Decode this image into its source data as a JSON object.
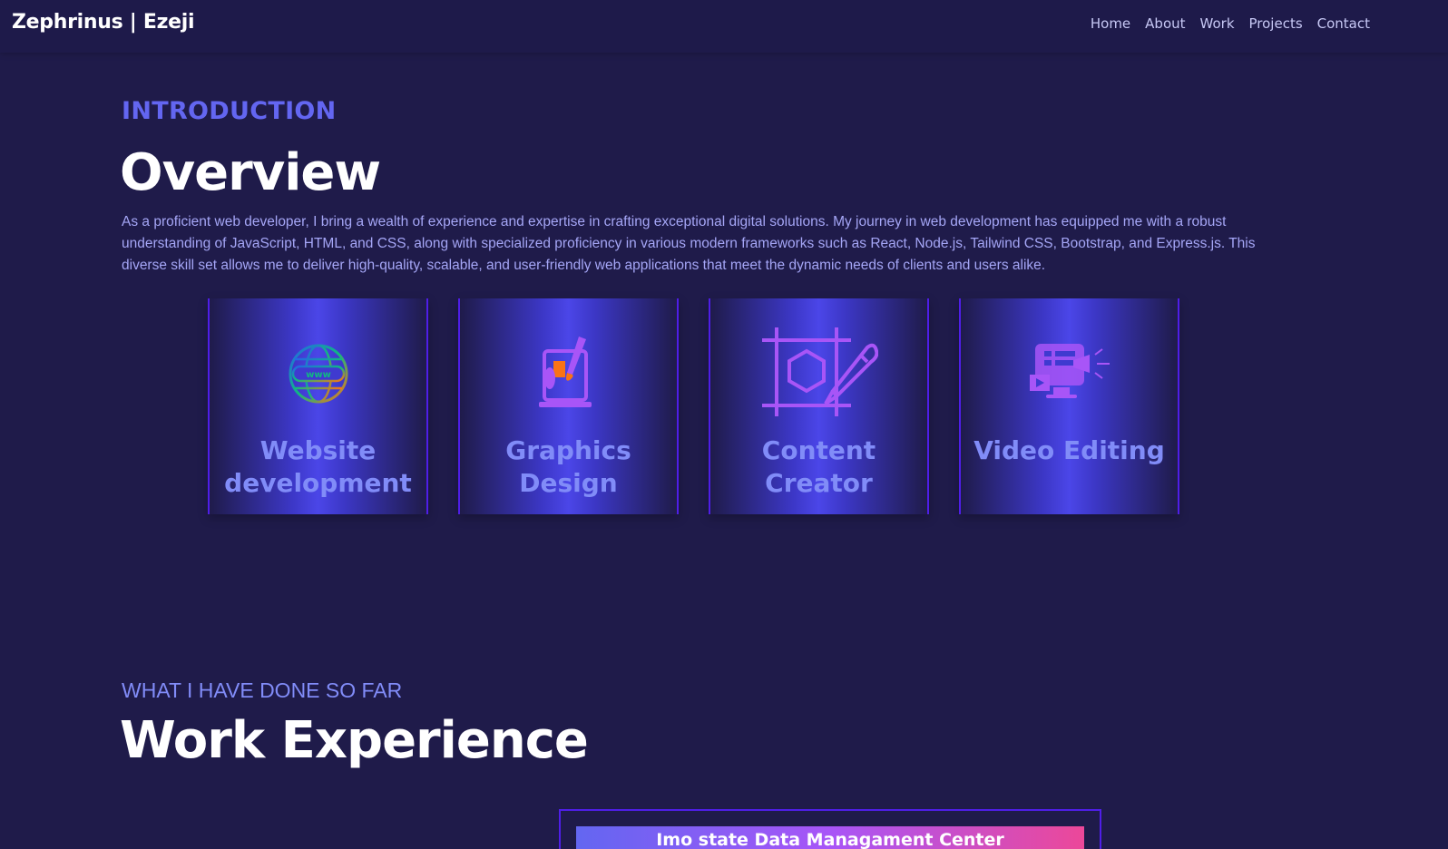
{
  "brand": "Zephrinus | Ezeji",
  "nav": [
    "Home",
    "About",
    "Work",
    "Projects",
    "Contact"
  ],
  "intro": {
    "label": "INTRODUCTION",
    "title": "Overview",
    "text": "As a proficient web developer, I bring a wealth of experience and expertise in crafting exceptional digital solutions. My journey in web development has equipped me with a robust understanding of JavaScript, HTML, and CSS, along with specialized proficiency in various modern frameworks such as React, Node.js, Tailwind CSS, Bootstrap, and Express.js. This diverse skill set allows me to deliver high-quality, scalable, and user-friendly web applications that meet the dynamic needs of clients and users alike."
  },
  "services": [
    {
      "label": "Website development",
      "icon": "globe-www-icon"
    },
    {
      "label": "Graphics Design",
      "icon": "graphics-tablet-icon"
    },
    {
      "label": "Content Creator",
      "icon": "design-pen-icon"
    },
    {
      "label": "Video Editing",
      "icon": "video-monitor-icon"
    }
  ],
  "work": {
    "label": "WHAT I HAVE DONE SO FAR",
    "title": "Work Experience",
    "first_item": "Imo state Data Managament Center"
  },
  "colors": {
    "background": "#1f1b4a",
    "accent": "#6366f1",
    "card_border": "#4f1ee8",
    "label": "#818cf8"
  }
}
